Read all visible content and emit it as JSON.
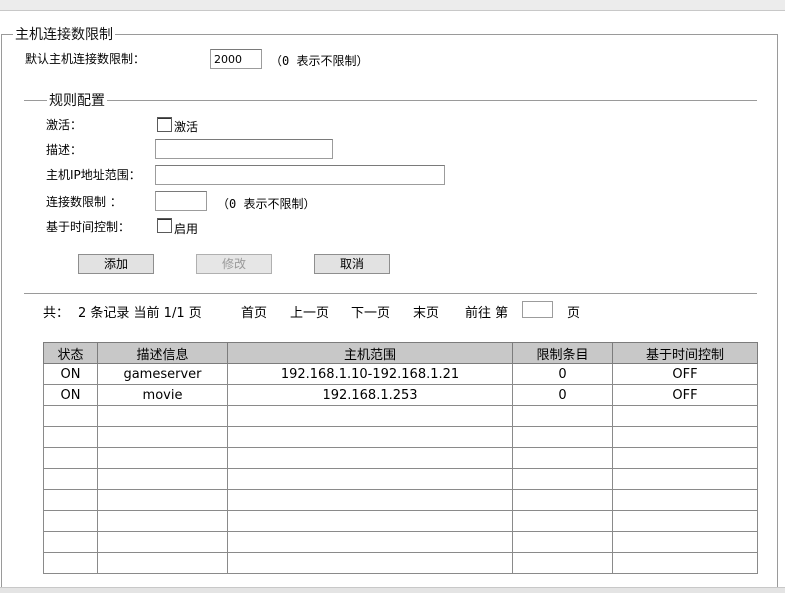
{
  "section_title": "主机连接数限制",
  "default_limit": {
    "label": "默认主机连接数限制：",
    "value": "2000",
    "hint": "（0 表示不限制）"
  },
  "rule_config": {
    "title": "规则配置",
    "activate_label": "激活：",
    "activate_checkbox_text": "激活",
    "desc_label": "描述：",
    "desc_value": "",
    "ip_range_label": "主机IP地址范围：",
    "ip_range_value": "",
    "conn_limit_label": "连接数限制 ：",
    "conn_limit_value": "",
    "conn_limit_hint": "（0 表示不限制）",
    "time_ctrl_label": "基于时间控制：",
    "time_ctrl_checkbox_text": "启用"
  },
  "buttons": {
    "add": "添加",
    "modify": "修改",
    "cancel": "取消"
  },
  "pager": {
    "total_prefix": "共：",
    "total": "2 条记录 当前 1/1 页",
    "first": "首页",
    "prev": "上一页",
    "next": "下一页",
    "last": "末页",
    "goto": "前往 第",
    "page_value": "",
    "page_suffix": "页"
  },
  "table": {
    "headers": [
      "状态",
      "描述信息",
      "主机范围",
      "限制条目",
      "基于时间控制"
    ],
    "rows": [
      [
        "ON",
        "gameserver",
        "192.168.1.10-192.168.1.21",
        "0",
        "OFF"
      ],
      [
        "ON",
        "movie",
        "192.168.1.253",
        "0",
        "OFF"
      ],
      [
        "",
        "",
        "",
        "",
        ""
      ],
      [
        "",
        "",
        "",
        "",
        ""
      ],
      [
        "",
        "",
        "",
        "",
        ""
      ],
      [
        "",
        "",
        "",
        "",
        ""
      ],
      [
        "",
        "",
        "",
        "",
        ""
      ],
      [
        "",
        "",
        "",
        "",
        ""
      ],
      [
        "",
        "",
        "",
        "",
        ""
      ],
      [
        "",
        "",
        "",
        "",
        ""
      ]
    ]
  }
}
